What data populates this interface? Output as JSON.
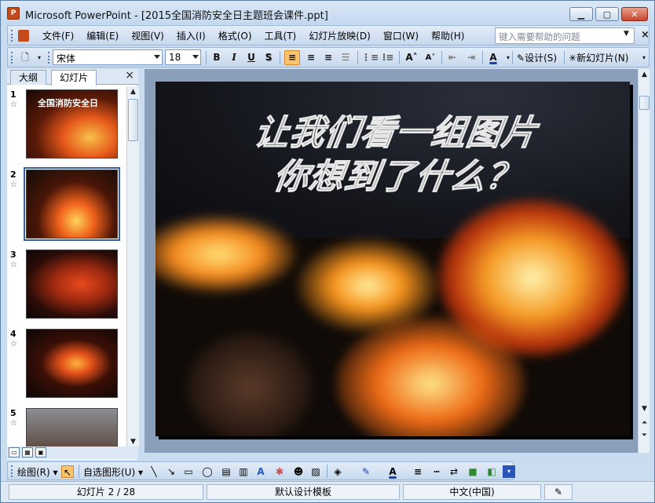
{
  "window": {
    "title": "Microsoft PowerPoint - [2015全国消防安全日主题班会课件.ppt]",
    "app_icon": "powerpoint-icon",
    "minimize_icon": "minimize-icon",
    "maximize_icon": "maximize-icon",
    "close_icon": "close-icon"
  },
  "menubar": {
    "items": [
      "文件(F)",
      "编辑(E)",
      "视图(V)",
      "插入(I)",
      "格式(O)",
      "工具(T)",
      "幻灯片放映(D)",
      "窗口(W)",
      "帮助(H)"
    ],
    "help_placeholder": "键入需要帮助的问题"
  },
  "toolbar": {
    "font_name": "宋体",
    "font_size": "18",
    "bold": "B",
    "italic": "I",
    "underline": "U",
    "shadow": "S",
    "design_label": "设计(S)",
    "new_slide_label": "新幻灯片(N)"
  },
  "pane": {
    "tab_outline": "大纲",
    "tab_slides": "幻灯片",
    "close": "×",
    "slides": [
      {
        "number": "1",
        "title": "全国消防安全日",
        "selected": false
      },
      {
        "number": "2",
        "title": "",
        "selected": true
      },
      {
        "number": "3",
        "title": "",
        "selected": false
      },
      {
        "number": "4",
        "title": "",
        "selected": false
      },
      {
        "number": "5",
        "title": "",
        "selected": false
      }
    ]
  },
  "slide": {
    "line1": "让我们看一组图片",
    "line2": "你想到了什么？"
  },
  "drawbar": {
    "draw_label": "绘图(R)",
    "autoshapes_label": "自选图形(U)"
  },
  "statusbar": {
    "slide_position": "幻灯片 2 / 28",
    "template": "默认设计模板",
    "language": "中文(中国)"
  },
  "colors": {
    "chrome": "#c9dcf0",
    "active_button": "#f9c36f",
    "selection": "#3a5fa0"
  }
}
